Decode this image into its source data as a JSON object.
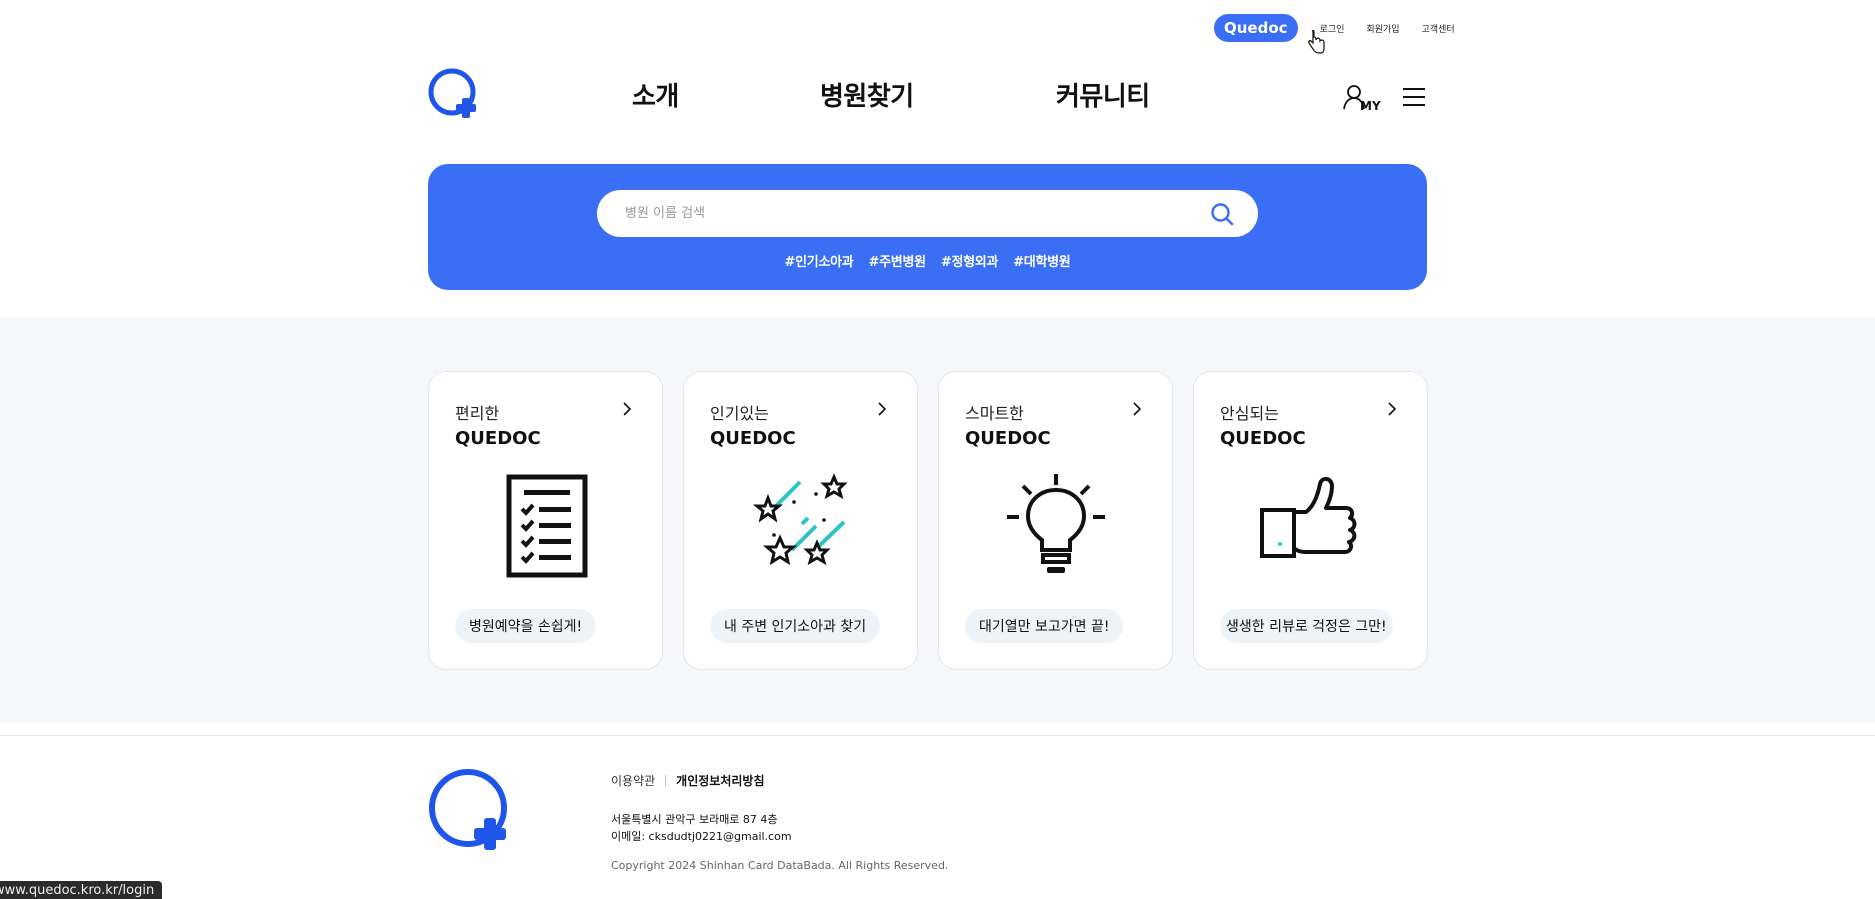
{
  "util": {
    "brand": "Quedoc",
    "login": "로그인",
    "signup": "회원가입",
    "support": "고객센터"
  },
  "nav": {
    "items": [
      "소개",
      "병원찾기",
      "커뮤니티"
    ],
    "my_label": "MY"
  },
  "search": {
    "placeholder": "병원 이름 검색",
    "tags": [
      "#인기소아과",
      "#주변병원",
      "#정형외과",
      "#대학병원"
    ]
  },
  "cards": [
    {
      "subtitle": "편리한",
      "title": "QUEDOC",
      "button": "병원예약을 손쉽게!",
      "icon": "checklist-icon"
    },
    {
      "subtitle": "인기있는",
      "title": "QUEDOC",
      "button": "내 주변 인기소아과 찾기",
      "icon": "shooting-stars-icon"
    },
    {
      "subtitle": "스마트한",
      "title": "QUEDOC",
      "button": "대기열만 보고가면 끝!",
      "icon": "lightbulb-icon"
    },
    {
      "subtitle": "안심되는",
      "title": "QUEDOC",
      "button": "생생한 리뷰로 걱정은 그만!",
      "icon": "thumbs-up-icon"
    }
  ],
  "footer": {
    "terms": "이용약관",
    "privacy": "개인정보처리방침",
    "address": "서울특별시 관악구 보라매로 87 4층",
    "email": "이메일: cksdudtj0221@gmail.com",
    "copyright": "Copyright 2024 Shinhan Card DataBada. All Rights Reserved."
  },
  "status_bar": {
    "url": "www.quedoc.kro.kr/login"
  },
  "colors": {
    "primary": "#3a6ff5",
    "accent": "#2ec4c4",
    "section_bg": "#f5f7fa"
  }
}
